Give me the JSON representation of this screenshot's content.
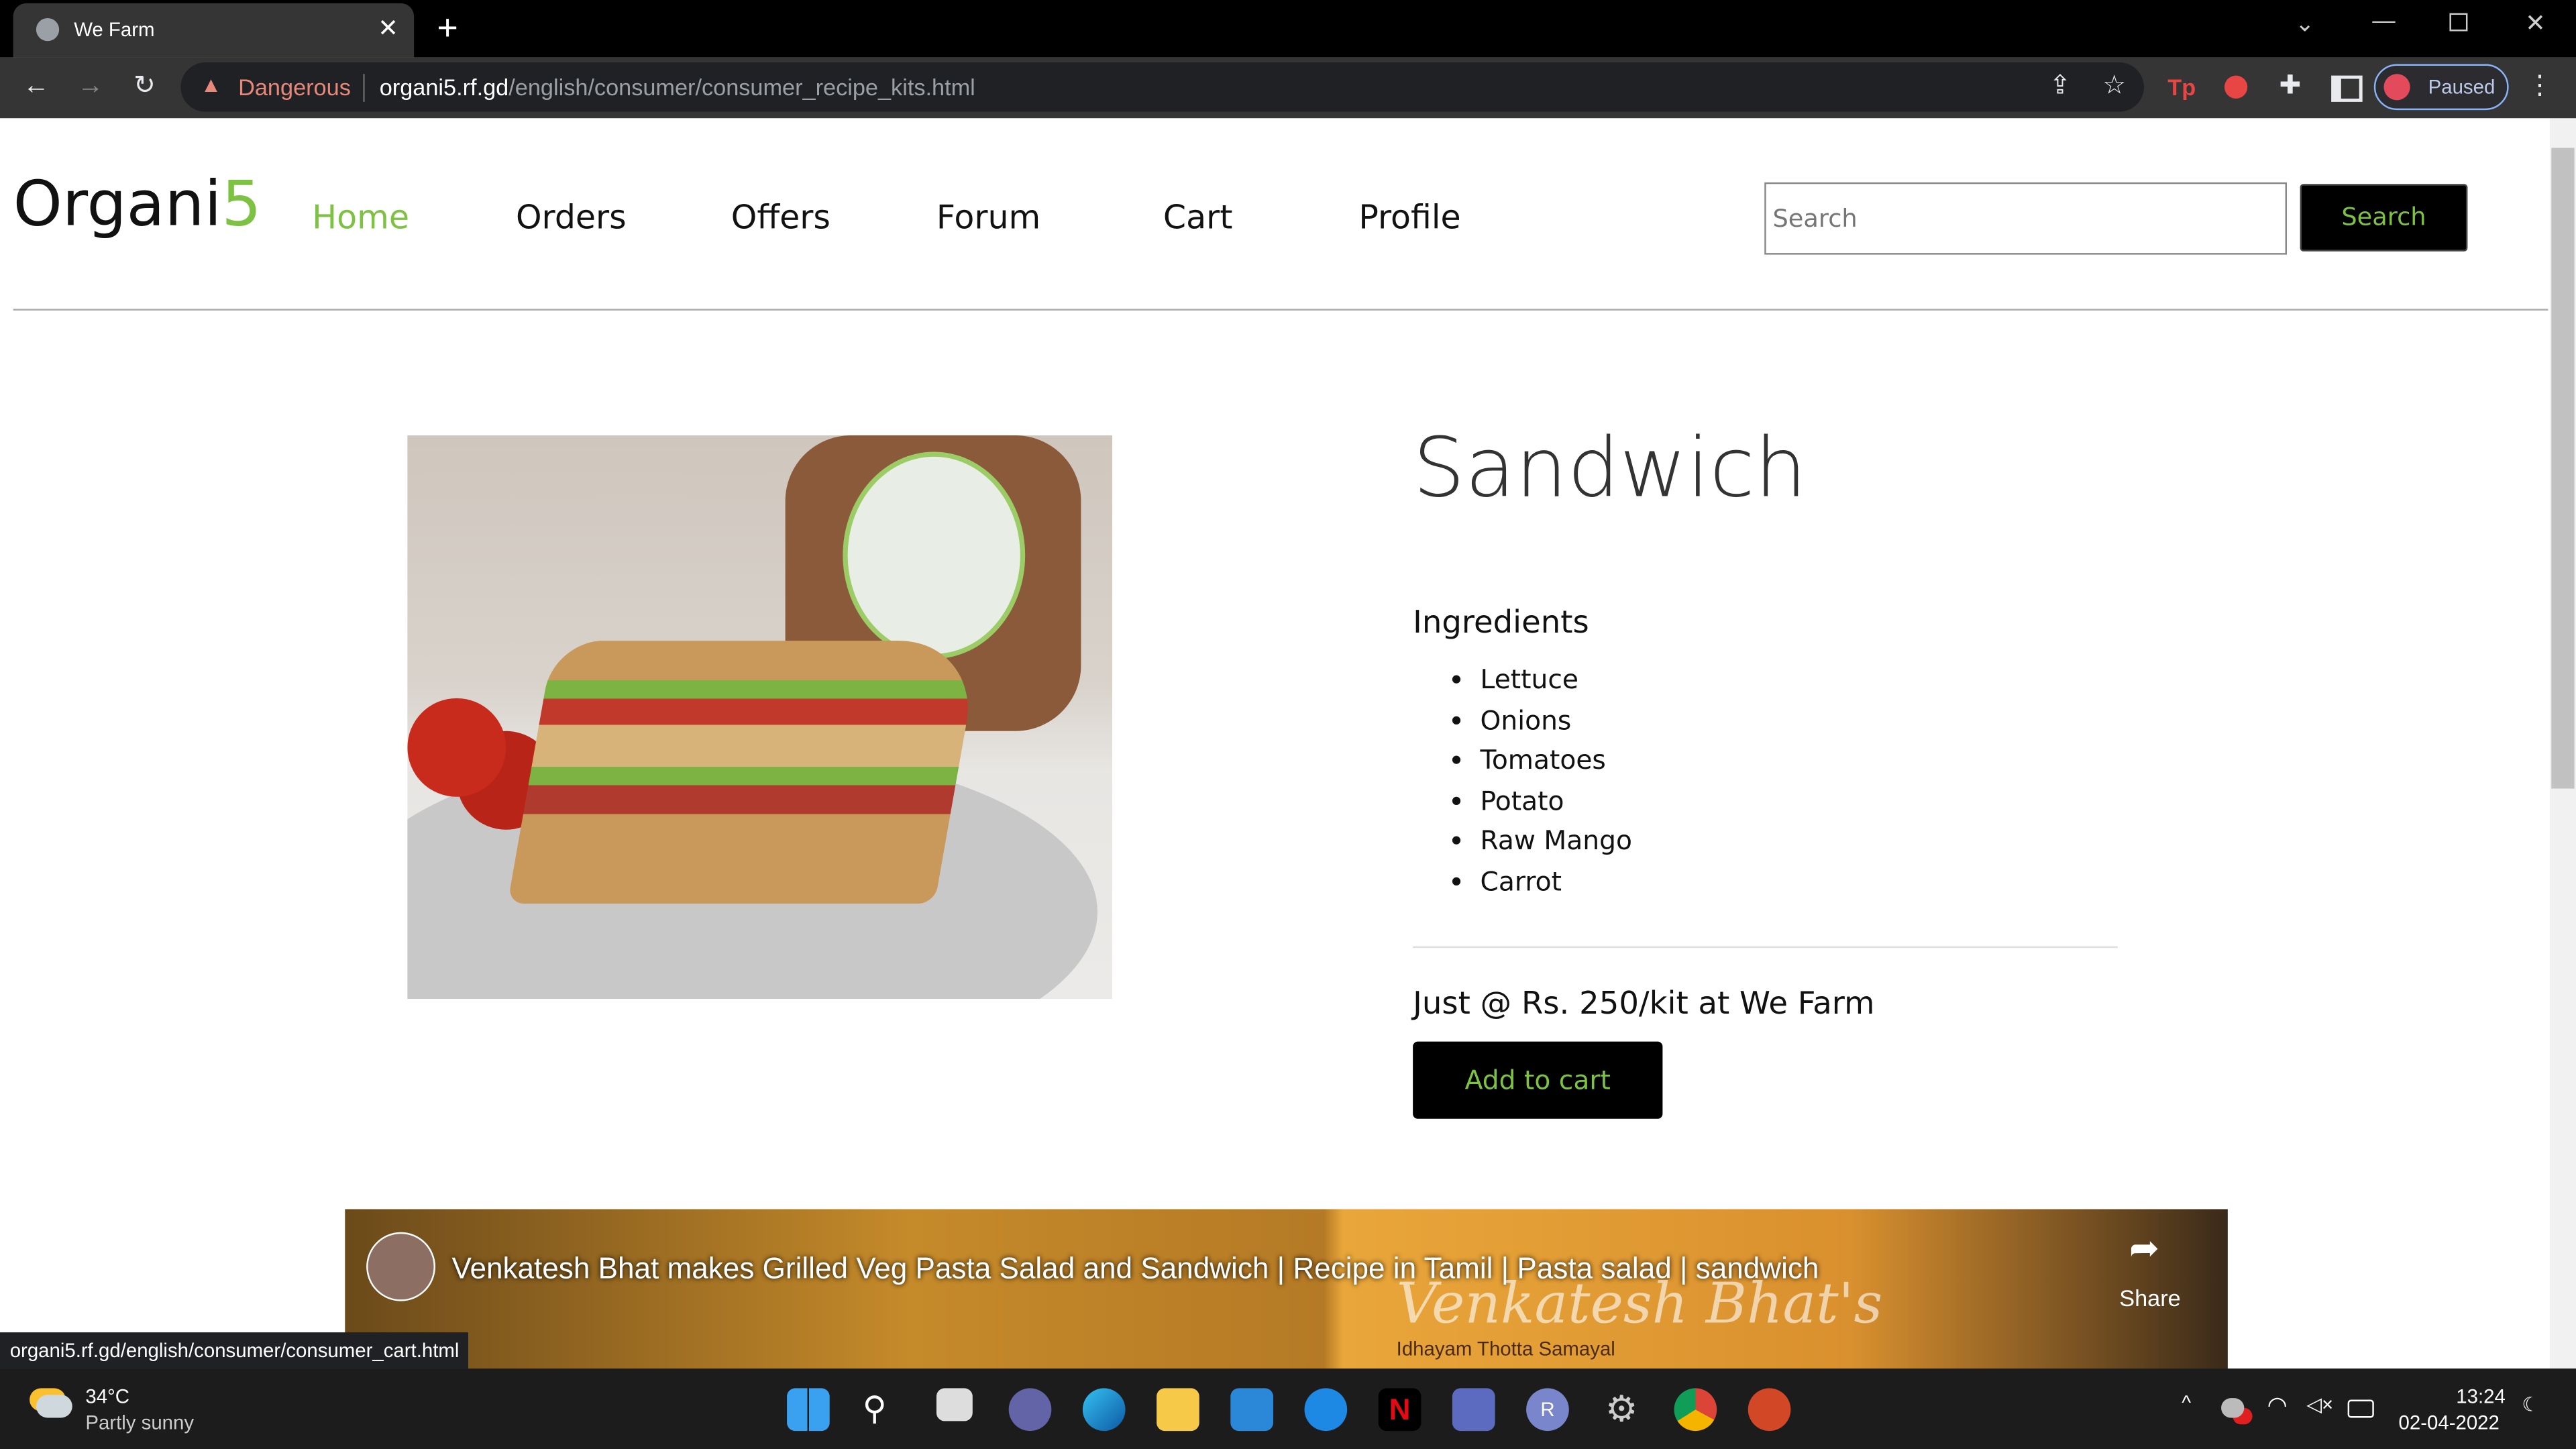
{
  "browser": {
    "tab_title": "We Farm",
    "security_label": "Dangerous",
    "url_host": "organi5.rf.gd",
    "url_path": "/english/consumer/consumer_recipe_kits.html",
    "profile_label": "Paused",
    "status_url": "organi5.rf.gd/english/consumer/consumer_cart.html"
  },
  "site": {
    "logo_text": "Organi",
    "logo_digit": "5",
    "nav": [
      {
        "label": "Home",
        "active": true
      },
      {
        "label": "Orders"
      },
      {
        "label": "Offers"
      },
      {
        "label": "Forum"
      },
      {
        "label": "Cart"
      },
      {
        "label": "Profile"
      }
    ],
    "search_placeholder": "Search",
    "search_button": "Search",
    "accent": "#7dc242"
  },
  "product": {
    "title": "Sandwich",
    "ingredients_heading": "Ingredients",
    "ingredients": [
      "Lettuce",
      "Onions",
      "Tomatoes",
      "Potato",
      "Raw Mango",
      "Carrot"
    ],
    "price_text": "Just @ Rs. 250/kit at We Farm",
    "add_to_cart": "Add to cart"
  },
  "video": {
    "title": "Venkatesh Bhat makes Grilled Veg Pasta Salad and Sandwich | Recipe in Tamil | Pasta salad | sandwich",
    "share_label": "Share",
    "watermark": "Venkatesh Bhat's",
    "watermark_sub": "Idhayam Thotta Samayal"
  },
  "taskbar": {
    "temp": "34°C",
    "weather": "Partly sunny",
    "time": "13:24",
    "date": "02-04-2022"
  }
}
